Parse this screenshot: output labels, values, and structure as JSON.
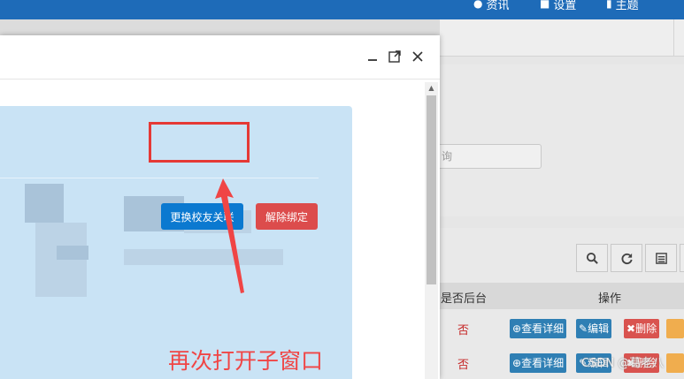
{
  "topbar": {
    "nav1": "资讯",
    "nav2": "设置",
    "nav3": "主题"
  },
  "modal": {
    "icons": [
      "minimize-icon",
      "maximize-icon",
      "close-icon"
    ],
    "primary_button": "更换校友关联",
    "danger_button": "解除绑定",
    "annotation": "再次打开子窗口"
  },
  "background": {
    "search_placeholder": "询",
    "table_headers": [
      "是否后台",
      "操作"
    ],
    "rows": [
      {
        "backend": "否",
        "actions": [
          "查看详细",
          "编辑",
          "删除"
        ]
      },
      {
        "backend": "否",
        "actions": [
          "查看详细",
          "编辑",
          "删除"
        ]
      }
    ],
    "watermark": "CSDN @葛老八"
  },
  "colors": {
    "topbar": "#1e6bb8",
    "primary": "#0b79d0",
    "danger": "#dc4c4c",
    "content_bg": "#c9e3f5",
    "annotation": "#f04545"
  }
}
